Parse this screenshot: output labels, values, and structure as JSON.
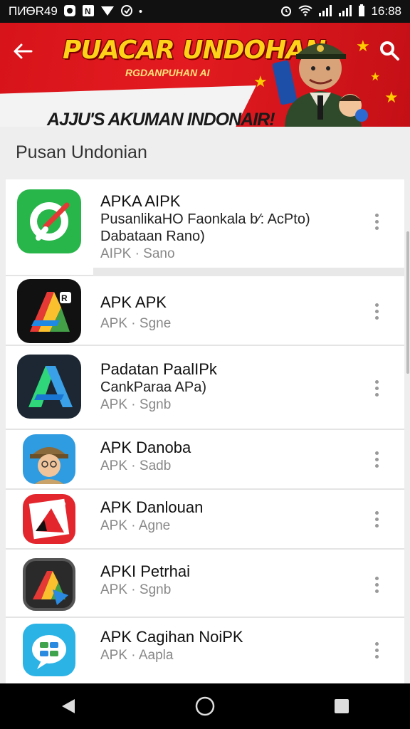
{
  "status_bar": {
    "left_text": "ПИ̇ӨR49",
    "time": "16:88"
  },
  "banner": {
    "title": "PUACAR UNDOHAN",
    "subtitle": "RGDANPUHAN AI",
    "slogan": "AJJU'S AKUMAN INDONAIR!"
  },
  "section": {
    "title": "Pusan Undonian"
  },
  "apps": [
    {
      "name": "APKA AIPK",
      "description": "PusanlikaHO Faonkala b⁄: AcPto) Dabataan Rano)",
      "meta": "AIPK · Sano",
      "icon": "green-chat-icon"
    },
    {
      "name": "APK APK",
      "description": "",
      "meta": "APK · Sgne",
      "icon": "colorful-a-icon"
    },
    {
      "name": "Padatan PaalIPk",
      "description": "CankParaa APa)",
      "meta": "APK · Sgnb",
      "icon": "navy-a-icon"
    },
    {
      "name": "APK Danoba",
      "description": "",
      "meta": "APK · Sadb",
      "icon": "explorer-avatar-icon"
    },
    {
      "name": "APK Danlouan",
      "description": "",
      "meta": "APK · Agne",
      "icon": "red-document-icon"
    },
    {
      "name": "APKI Petrhai",
      "description": "",
      "meta": "APK · Sgnb",
      "icon": "black-triangle-icon"
    },
    {
      "name": "APK Cagihan NoiPK",
      "description": "",
      "meta": "APK · Aapla",
      "icon": "chat-bubble-icon"
    }
  ],
  "colors": {
    "banner_red": "#e31b20",
    "banner_yellow": "#ffd21a"
  }
}
